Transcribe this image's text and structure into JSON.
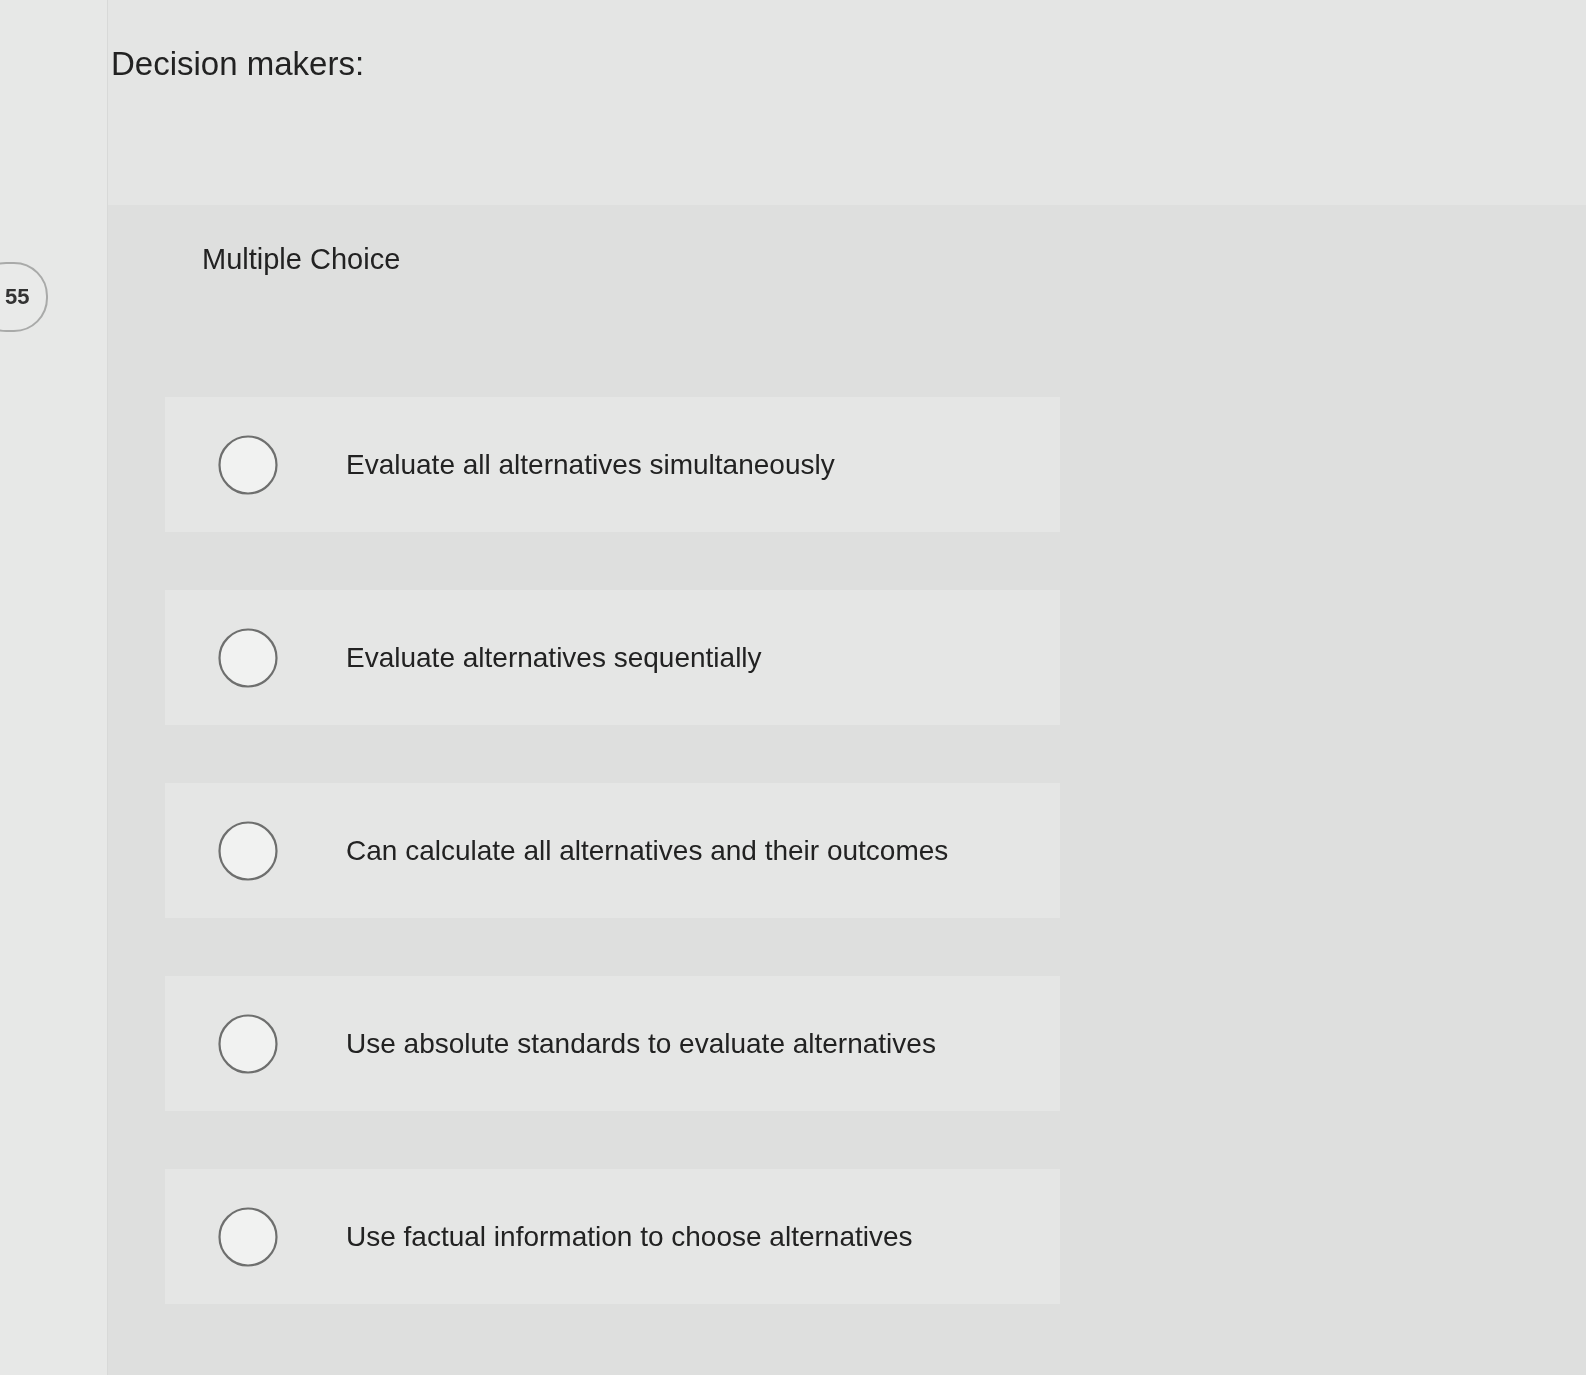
{
  "timer_badge": {
    "text": "55"
  },
  "question": {
    "prompt": "Decision makers:",
    "type_label": "Multiple Choice",
    "choices": [
      {
        "label": "Evaluate all alternatives simultaneously",
        "selected": false
      },
      {
        "label": "Evaluate alternatives sequentially",
        "selected": false
      },
      {
        "label": "Can calculate all alternatives and their outcomes",
        "selected": false
      },
      {
        "label": "Use absolute standards to evaluate alternatives",
        "selected": false
      },
      {
        "label": "Use factual information to choose alternatives",
        "selected": false
      }
    ]
  }
}
